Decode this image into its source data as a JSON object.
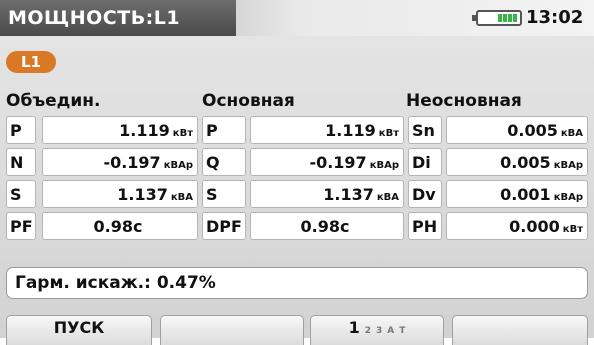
{
  "title": {
    "screen": "МОЩНОСТЬ:L1",
    "time": "13:02"
  },
  "battery": {
    "icon": "battery-icon",
    "level_fraction": 0.6,
    "color": "#39b54a"
  },
  "phase": {
    "label": "L1",
    "color": "#d97926"
  },
  "groups": {
    "combined": {
      "title": "Объедин.",
      "rows": [
        {
          "label": "P",
          "value": "1.119",
          "unit": "кВт"
        },
        {
          "label": "N",
          "value": "-0.197",
          "unit": "кВАр"
        },
        {
          "label": "S",
          "value": "1.137",
          "unit": "кВА"
        },
        {
          "label": "PF",
          "value": "0.98c",
          "unit": ""
        }
      ]
    },
    "fundamental": {
      "title": "Основная",
      "rows": [
        {
          "label": "P",
          "value": "1.119",
          "unit": "кВт"
        },
        {
          "label": "Q",
          "value": "-0.197",
          "unit": "кВАр"
        },
        {
          "label": "S",
          "value": "1.137",
          "unit": "кВА"
        },
        {
          "label": "DPF",
          "value": "0.98c",
          "unit": ""
        }
      ]
    },
    "nonfundamental": {
      "title": "Неосновная",
      "rows": [
        {
          "label": "Sn",
          "value": "0.005",
          "unit": "кВА"
        },
        {
          "label": "Di",
          "value": "0.005",
          "unit": "кВАр"
        },
        {
          "label": "Dv",
          "value": "0.001",
          "unit": "кВАр"
        },
        {
          "label": "PH",
          "value": "0.000",
          "unit": "кВт"
        }
      ]
    }
  },
  "thd": "Гарм. искаж.: 0.47%",
  "buttons": {
    "start": "ПУСК",
    "pages": {
      "current": "1",
      "others": [
        "2",
        "3",
        "A",
        "T"
      ]
    }
  }
}
